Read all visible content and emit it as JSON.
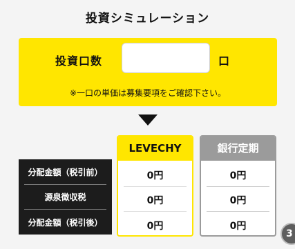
{
  "title": "投資シミュレーション",
  "input": {
    "label": "投資口数",
    "value": "",
    "suffix": "口"
  },
  "note": "※一口の単価は募集要項をご確認下さい。",
  "table": {
    "columns": {
      "levechy": "LEVECHY",
      "bank": "銀行定期"
    },
    "rows": [
      {
        "label": "分配金額（税引前）",
        "levechy": "0円",
        "bank": "0円"
      },
      {
        "label": "源泉徴収税",
        "levechy": "0円",
        "bank": "0円"
      },
      {
        "label": "分配金額（税引後）",
        "levechy": "0円",
        "bank": "0円"
      }
    ]
  },
  "colors": {
    "accent": "#ffe600",
    "bank_header": "#9b9b9b",
    "label_background": "#1c1c1c"
  },
  "floating_widget_icon": "chat-widget-icon"
}
